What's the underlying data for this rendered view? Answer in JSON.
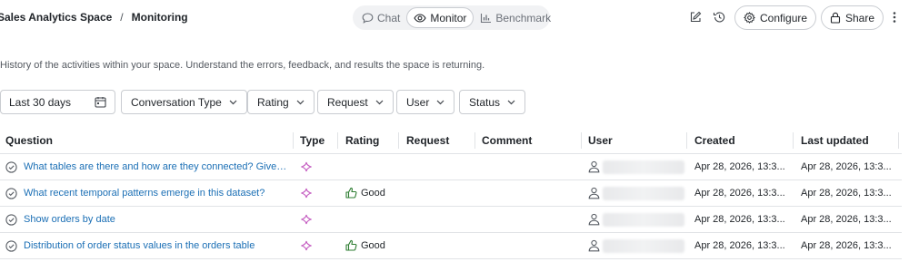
{
  "breadcrumb": {
    "space": "Sales Analytics Space",
    "separator": "/",
    "page": "Monitoring"
  },
  "view_tabs": [
    {
      "label": "Chat",
      "icon": "chat-bubble-icon",
      "active": false
    },
    {
      "label": "Monitor",
      "icon": "eye-icon",
      "active": true
    },
    {
      "label": "Benchmark",
      "icon": "bar-chart-icon",
      "active": false
    }
  ],
  "header_actions": {
    "configure_label": "Configure",
    "share_label": "Share"
  },
  "description": "History of the activities within your space. Understand the errors, feedback, and results the space is returning.",
  "filters": {
    "date_range": "Last 30 days",
    "conversation_type": "Conversation Type",
    "rating": "Rating",
    "request": "Request",
    "user": "User",
    "status": "Status"
  },
  "table": {
    "columns": [
      "Question",
      "Type",
      "Rating",
      "Request",
      "Comment",
      "User",
      "Created",
      "Last updated"
    ],
    "rows": [
      {
        "question": "What tables are there and how are they connected? Give me a short summary.",
        "rating": "",
        "created": "Apr 28, 2026, 13:3...",
        "updated": "Apr 28, 2026, 13:3..."
      },
      {
        "question": "What recent temporal patterns emerge in this dataset?",
        "rating": "Good",
        "created": "Apr 28, 2026, 13:3...",
        "updated": "Apr 28, 2026, 13:3..."
      },
      {
        "question": "Show orders by date",
        "rating": "",
        "created": "Apr 28, 2026, 13:3...",
        "updated": "Apr 28, 2026, 13:3..."
      },
      {
        "question": "Distribution of order status values in the orders table",
        "rating": "Good",
        "created": "Apr 28, 2026, 13:3...",
        "updated": "Apr 28, 2026, 13:3..."
      }
    ]
  },
  "colors": {
    "link": "#1b6fb5",
    "type_icon": "#c45bc0",
    "rating_good": "#2e7d32",
    "border": "#c9ccd1"
  }
}
